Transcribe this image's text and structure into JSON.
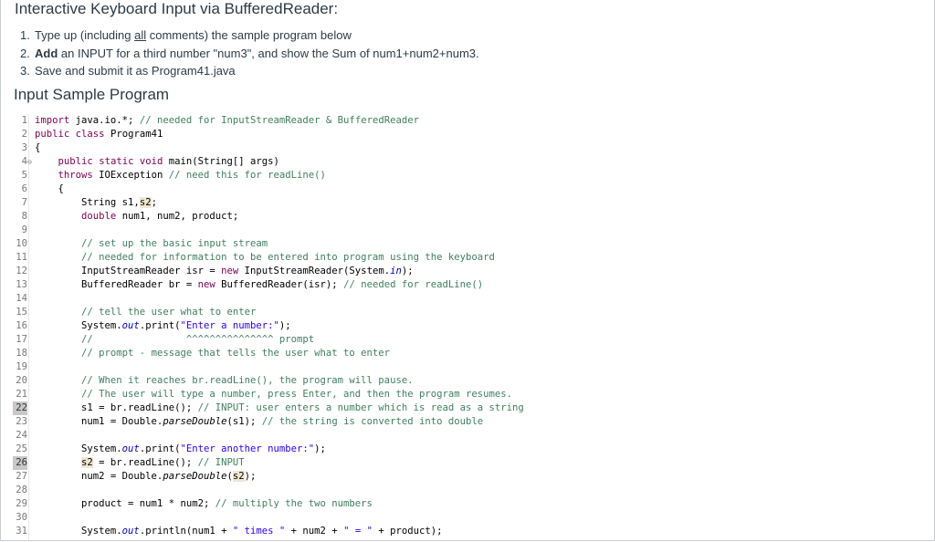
{
  "page": {
    "title": "Interactive Keyboard Input via BufferedReader:"
  },
  "instructions": [
    {
      "num": "1.",
      "before": "Type up (including ",
      "emphasis": "all",
      "after": " comments) the sample program below"
    },
    {
      "num": "2.",
      "before": "",
      "emphasis": "Add",
      "after": " an INPUT for a third number \"num3\", and show the Sum of num1+num2+num3."
    },
    {
      "num": "3.",
      "before": "Save and submit it as Program41.java",
      "emphasis": "",
      "after": ""
    }
  ],
  "section_heading": "Input Sample Program",
  "code": {
    "language": "java",
    "lines": [
      {
        "n": "1",
        "text": "import java.io.*; // needed for InputStreamReader & BufferedReader"
      },
      {
        "n": "2",
        "text": "public class Program41"
      },
      {
        "n": "3",
        "text": "{"
      },
      {
        "n": "4",
        "text": "    public static void main(String[] args)",
        "marker": "⊖"
      },
      {
        "n": "5",
        "text": "    throws IOException // need this for readLine()"
      },
      {
        "n": "6",
        "text": "    {"
      },
      {
        "n": "7",
        "text": "        String s1,s2;"
      },
      {
        "n": "8",
        "text": "        double num1, num2, product;"
      },
      {
        "n": "9",
        "text": ""
      },
      {
        "n": "10",
        "text": "        // set up the basic input stream"
      },
      {
        "n": "11",
        "text": "        // needed for information to be entered into program using the keyboard"
      },
      {
        "n": "12",
        "text": "        InputStreamReader isr = new InputStreamReader(System.in);"
      },
      {
        "n": "13",
        "text": "        BufferedReader br = new BufferedReader(isr); // needed for readLine()"
      },
      {
        "n": "14",
        "text": ""
      },
      {
        "n": "15",
        "text": "        // tell the user what to enter"
      },
      {
        "n": "16",
        "text": "        System.out.print(\"Enter a number:\");"
      },
      {
        "n": "17",
        "text": "        //                ^^^^^^^^^^^^^^^ prompt"
      },
      {
        "n": "18",
        "text": "        // prompt - message that tells the user what to enter"
      },
      {
        "n": "19",
        "text": ""
      },
      {
        "n": "20",
        "text": "        // When it reaches br.readLine(), the program will pause."
      },
      {
        "n": "21",
        "text": "        // The user will type a number, press Enter, and then the program resumes."
      },
      {
        "n": "22",
        "text": "        s1 = br.readLine(); // INPUT: user enters a number which is read as a string",
        "highlight": true
      },
      {
        "n": "23",
        "text": "        num1 = Double.parseDouble(s1); // the string is converted into double"
      },
      {
        "n": "24",
        "text": ""
      },
      {
        "n": "25",
        "text": "        System.out.print(\"Enter another number:\");"
      },
      {
        "n": "26",
        "text": "        s2 = br.readLine(); // INPUT",
        "highlight": true
      },
      {
        "n": "27",
        "text": "        num2 = Double.parseDouble(s2);"
      },
      {
        "n": "28",
        "text": ""
      },
      {
        "n": "29",
        "text": "        product = num1 * num2; // multiply the two numbers"
      },
      {
        "n": "30",
        "text": ""
      },
      {
        "n": "31",
        "text": "        System.out.println(num1 + \" times \" + num2 + \" = \" + product);"
      }
    ]
  },
  "colors": {
    "keyword": "#7f0055",
    "comment": "#3f7f5f",
    "string": "#2a00ff",
    "field": "#0000c0",
    "occurrence": "#f0e7d1"
  }
}
